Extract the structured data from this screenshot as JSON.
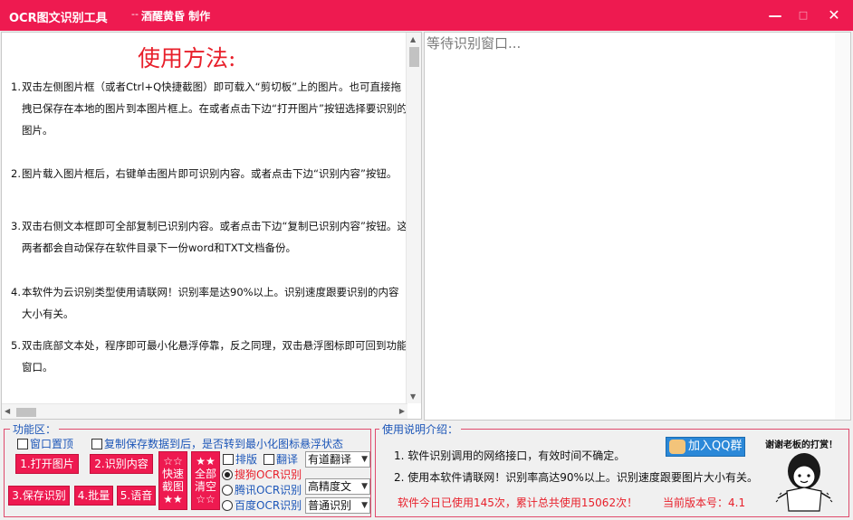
{
  "window": {
    "title": "OCR图文识别工具",
    "title_sep": "--",
    "subtitle": "酒醒黄昏 制作",
    "min_glyph": "—",
    "max_glyph": "□",
    "close_glyph": "✕"
  },
  "instructions": {
    "title": "使用方法:",
    "items": [
      {
        "num": "1.",
        "text": "双击左侧图片框（或者Ctrl+Q快捷截图）即可载入“剪切板”上的图片。也可直接拖拽已保存在本地的图片到本图片框上。在或者点击下边“打开图片”按钮选择要识别的图片。"
      },
      {
        "num": "2.",
        "text": "图片载入图片框后，右键单击图片即可识别内容。或者点击下边“识别内容”按钮。"
      },
      {
        "num": "3.",
        "text": "双击右侧文本框即可全部复制已识别内容。或者点击下边“复制已识别内容”按钮。这两者都会自动保存在软件目录下一份word和TXT文档备份。"
      },
      {
        "num": "4.",
        "text": "本软件为云识别类型使用请联网！识别率是达90%以上。识别速度跟要识别的内容大小有关。"
      },
      {
        "num": "5.",
        "text": "双击底部文本处，程序即可最小化悬浮停靠，反之同理，双击悬浮图标即可回到功能窗口。"
      }
    ]
  },
  "result": {
    "placeholder_text": "等待识别窗口..."
  },
  "functions": {
    "legend": "功能区：",
    "chk_topmost": "窗口置顶",
    "chk_copy_float": "复制保存数据到后，是否转到最小化图标悬浮状态",
    "btn_open": "1.打开图片",
    "btn_recognize": "2.识别内容",
    "btn_save": "3.保存识别",
    "btn_batch": "4.批量",
    "btn_voice": "5.语音",
    "btn_quick": [
      "☆☆",
      "快速",
      "截图",
      "★★"
    ],
    "btn_clear": [
      "★★",
      "全部",
      "清空",
      "☆☆"
    ],
    "chk_layout": "排版",
    "chk_translate": "翻译",
    "radio_sogou": "搜狗OCR识别",
    "radio_tencent": "腾讯OCR识别",
    "radio_baidu": "百度OCR识别",
    "selected_engine": "搜狗OCR识别",
    "combo_translate": "有道翻译",
    "combo_precision": "高精度文",
    "combo_mode": "普通识别",
    "combo_arrow": "▼"
  },
  "guide": {
    "legend": "使用说明介绍：",
    "line1": "1. 软件识别调用的网络接口，有效时间不确定。",
    "line2": "2. 使用本软件请联网！识别率高达90%以上。识别速度跟要图片大小有关。",
    "stats": "软件今日已使用145次，累计总共使用15062次！",
    "version": "当前版本号：4.1",
    "qq_button": "加入QQ群",
    "thanks": "谢谢老板的打赏！"
  },
  "colors": {
    "accent": "#ee1a50",
    "title_red": "#e8202b",
    "link_blue": "#1c56b8",
    "qq_blue": "#2b88d8"
  }
}
